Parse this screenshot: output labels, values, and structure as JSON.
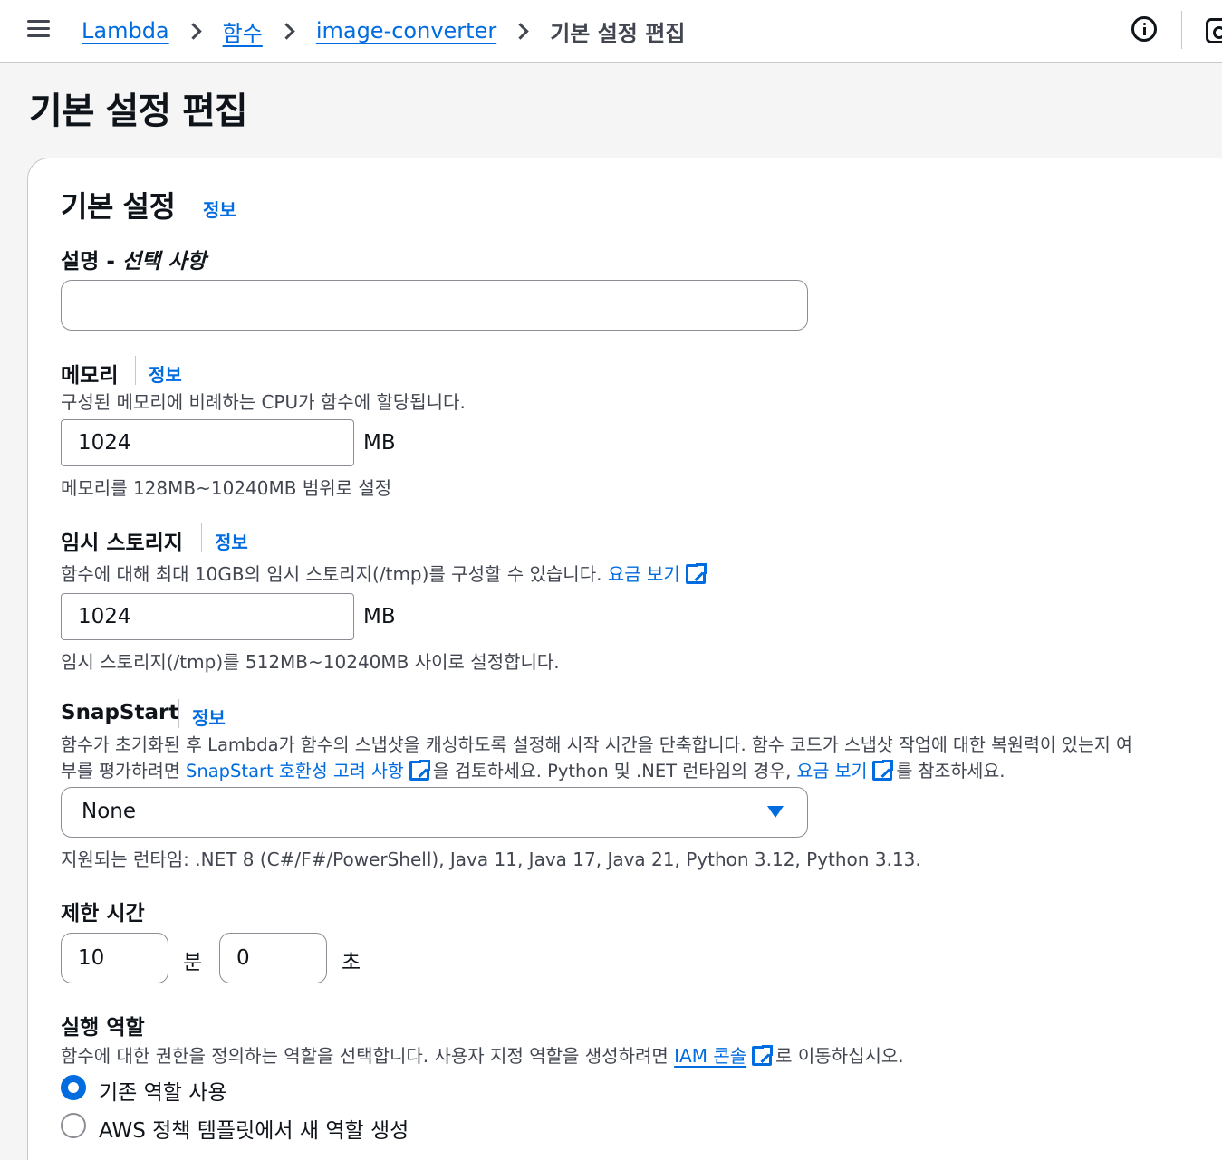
{
  "breadcrumb": {
    "items": [
      "Lambda",
      "함수",
      "image-converter"
    ],
    "current": "기본 설정 편집"
  },
  "page_title": "기본 설정 편집",
  "section": {
    "title": "기본 설정",
    "info": "정보"
  },
  "description_field": {
    "label": "설명 - ",
    "label_optional": "선택 사항",
    "value": ""
  },
  "memory": {
    "label": "메모리",
    "info": "정보",
    "description": "구성된 메모리에 비례하는 CPU가 함수에 할당됩니다.",
    "value": "1024",
    "unit": "MB",
    "hint": "메모리를 128MB~10240MB 범위로 설정"
  },
  "ephemeral_storage": {
    "label": "임시 스토리지",
    "info": "정보",
    "description": "함수에 대해 최대 10GB의 임시 스토리지(/tmp)를 구성할 수 있습니다.",
    "pricing_link": "요금 보기",
    "value": "1024",
    "unit": "MB",
    "hint": "임시 스토리지(/tmp)를 512MB~10240MB 사이로 설정합니다."
  },
  "snapstart": {
    "label": "SnapStart",
    "info": "정보",
    "description_line1": "함수가 초기화된 후 Lambda가 함수의 스냅샷을 캐싱하도록 설정해 시작 시간을 단축합니다. 함수 코드가 스냅샷 작업에 대한 복원력이 있는지 여",
    "description_line2_prefix": "부를 평가하려면 ",
    "compat_link": "SnapStart 호환성 고려 사항",
    "description_line2_mid": "을 검토하세요. Python 및 .NET 런타임의 경우, ",
    "pricing_link": "요금 보기",
    "description_line2_suffix": "를 참조하세요.",
    "selected": "None",
    "hint": "지원되는 런타임: .NET 8 (C#/F#/PowerShell), Java 11, Java 17, Java 21, Python 3.12, Python 3.13."
  },
  "timeout": {
    "label": "제한 시간",
    "minutes": "10",
    "minutes_unit": "분",
    "seconds": "0",
    "seconds_unit": "초"
  },
  "execution_role": {
    "label": "실행 역할",
    "description_prefix": "함수에 대한 권한을 정의하는 역할을 선택합니다. 사용자 지정 역할을 생성하려면 ",
    "iam_link": "IAM 콘솔",
    "description_suffix": "로 이동하십시오.",
    "options": [
      "기존 역할 사용",
      "AWS 정책 템플릿에서 새 역할 생성"
    ],
    "selected_index": 0
  },
  "colors": {
    "link": "#006ce0",
    "text": "#0f141a",
    "secondary_text": "#424650",
    "border": "#8c8c94",
    "page_background": "#f5f5f6"
  }
}
